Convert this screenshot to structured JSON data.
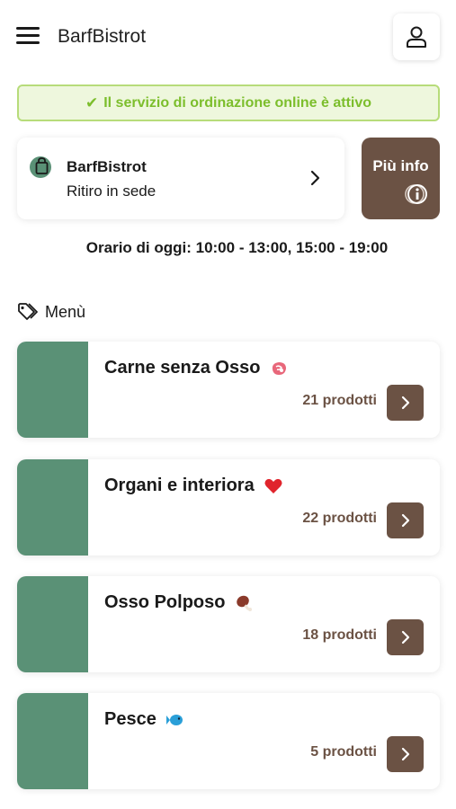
{
  "header": {
    "title": "BarfBistrot",
    "menu_icon": "hamburger-icon",
    "user_icon": "user-icon"
  },
  "status": {
    "text": "Il servizio di ordinazione online è attivo",
    "icon": "check-icon",
    "color": "#7cbe2c"
  },
  "store": {
    "name": "BarfBistrot",
    "mode": "Ritiro in sede",
    "icon": "shopping-bag-icon"
  },
  "info_button": {
    "label": "Più info",
    "icon": "info-icon"
  },
  "hours": "Orario di oggi: 10:00 - 13:00, 15:00 - 19:00",
  "menu": {
    "label": "Menù",
    "icon": "tag-icon"
  },
  "categories": [
    {
      "name": "Carne senza Osso",
      "count": "21 prodotti",
      "emoji": "meat-icon"
    },
    {
      "name": "Organi e interiora",
      "count": "22 prodotti",
      "emoji": "heart-icon"
    },
    {
      "name": "Osso Polposo",
      "count": "18 prodotti",
      "emoji": "drumstick-icon"
    },
    {
      "name": "Pesce",
      "count": "5 prodotti",
      "emoji": "fish-icon"
    }
  ],
  "colors": {
    "brand_brown": "#6b5244",
    "brand_green": "#5a9176",
    "success_green": "#7cbe2c"
  }
}
